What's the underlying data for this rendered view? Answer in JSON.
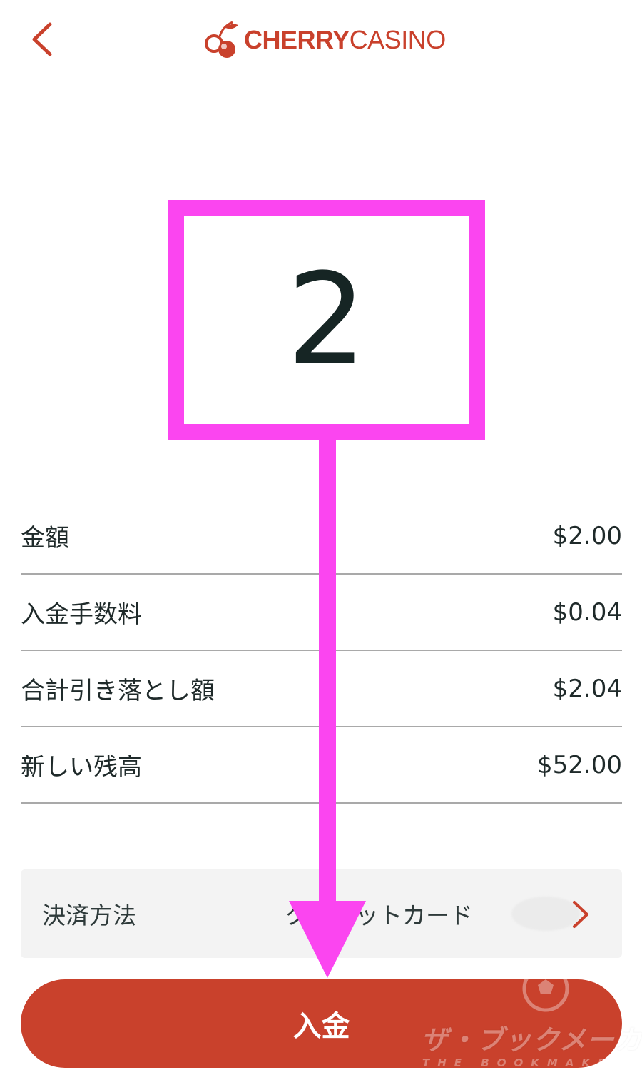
{
  "header": {
    "back_icon": "chevron-left-icon",
    "logo": {
      "icon": "cherry-icon",
      "text_bold": "CHERRY",
      "text_light": "CASINO"
    }
  },
  "annotation": {
    "step_number": "2",
    "color": "#fb45f0"
  },
  "summary": {
    "rows": [
      {
        "label": "金額",
        "value": "$2.00"
      },
      {
        "label": "入金手数料",
        "value": "$0.04"
      },
      {
        "label": "合計引き落とし額",
        "value": "$2.04"
      },
      {
        "label": "新しい残高",
        "value": "$52.00"
      }
    ]
  },
  "payment_method": {
    "label": "決済方法",
    "value": "クレジットカード",
    "chevron_icon": "chevron-right-icon"
  },
  "deposit_button": {
    "label": "入金"
  },
  "watermark": {
    "text": "ザ・ブックメーカーズ",
    "sub": "THE BOOKMAKERS",
    "icon": "soccer-ball-icon"
  },
  "colors": {
    "brand": "#c9412c",
    "annotation": "#fb45f0",
    "text": "#1f2a2a",
    "divider": "#a9a9a9",
    "panel": "#f3f3f3"
  }
}
